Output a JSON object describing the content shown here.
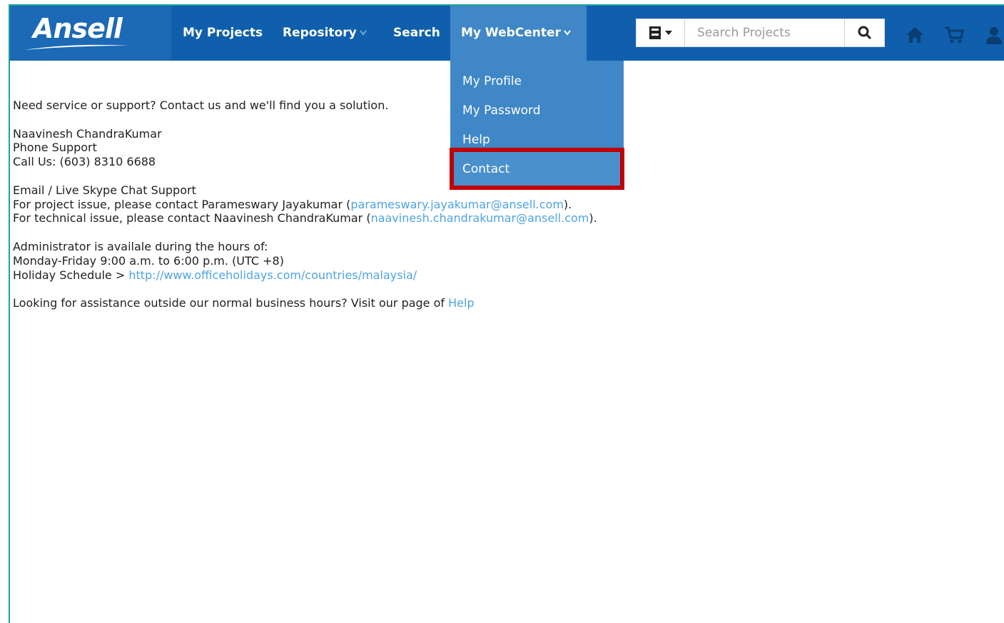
{
  "brand": {
    "logo_text": "Ansell"
  },
  "nav": {
    "my_projects": "My Projects",
    "repository": "Repository",
    "search": "Search",
    "my_webcenter": "My WebCenter"
  },
  "search": {
    "placeholder": "Search Projects"
  },
  "icons": {
    "filter": "file-cabinet-icon",
    "search": "magnifier-icon",
    "home": "home-icon",
    "cart": "cart-icon",
    "user": "user-icon"
  },
  "dropdown": {
    "items": [
      "My Profile",
      "My Password",
      "Help",
      "Contact"
    ]
  },
  "content": {
    "intro": "Need service or support? Contact us and we'll find you a solution.",
    "name": "Naavinesh ChandraKumar",
    "phone_support": "Phone Support",
    "call_us": "Call Us: (603) 8310 6688",
    "email_heading": "Email / Live Skype Chat Support",
    "project_prefix": "For project issue, please contact Parameswary Jayakumar (",
    "project_email": "parameswary.jayakumar@ansell.com",
    "project_suffix": ").",
    "tech_prefix": "For technical issue, please contact Naavinesh ChandraKumar (",
    "tech_email": "naavinesh.chandrakumar@ansell.com",
    "tech_suffix": ").",
    "admin_hours": "Administrator is availale during the hours of:",
    "hours": "Monday-Friday 9:00 a.m. to 6:00 p.m. (UTC +8)",
    "holiday_prefix": "Holiday Schedule > ",
    "holiday_link": "http://www.officeholidays.com/countries/malaysia/",
    "outside_prefix": "Looking for assistance outside our normal business hours? Visit our page of ",
    "outside_link": "Help"
  },
  "colors": {
    "navbar": "#0f5fad",
    "active": "#3f87c7",
    "highlight_border": "#c00000",
    "link": "#4fa3e6"
  }
}
